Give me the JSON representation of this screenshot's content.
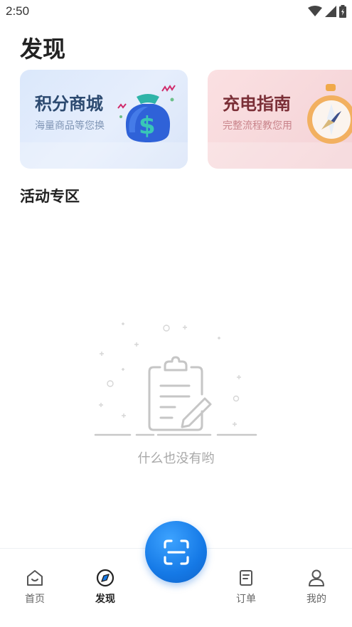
{
  "status_bar": {
    "time": "2:50"
  },
  "page": {
    "title": "发现"
  },
  "cards": [
    {
      "title": "积分商城",
      "subtitle": "海量商品等您换",
      "icon": "money-bag-icon"
    },
    {
      "title": "充电指南",
      "subtitle": "完整流程教您用",
      "icon": "compass-icon"
    }
  ],
  "activity": {
    "title": "活动专区",
    "empty_text": "什么也没有哟",
    "empty_icon": "clipboard-edit-icon"
  },
  "tabbar": {
    "items": [
      {
        "label": "首页",
        "icon": "home-icon"
      },
      {
        "label": "发现",
        "icon": "compass-icon",
        "active": true
      },
      {
        "label": "订单",
        "icon": "order-icon"
      },
      {
        "label": "我的",
        "icon": "user-icon"
      }
    ],
    "center_button": {
      "icon": "scan-icon"
    }
  },
  "colors": {
    "accent": "#1579e6",
    "points_card": "#dbe8fb",
    "guide_card": "#fbe0e2"
  }
}
